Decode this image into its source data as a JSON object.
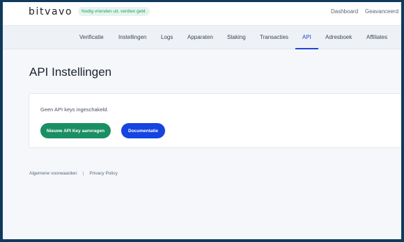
{
  "topbar": {
    "logo": "bitvavo",
    "promo": "Nodig vrienden uit, verdien geld.",
    "links": [
      "Dashboard",
      "Geavanceerd"
    ]
  },
  "subnav": {
    "tabs": [
      {
        "label": "Verificatie"
      },
      {
        "label": "Instellingen"
      },
      {
        "label": "Logs"
      },
      {
        "label": "Apparaten"
      },
      {
        "label": "Staking"
      },
      {
        "label": "Transacties"
      },
      {
        "label": "API"
      },
      {
        "label": "Adresboek"
      },
      {
        "label": "Affiliates"
      }
    ],
    "active": "API"
  },
  "main": {
    "title": "API Instellingen",
    "message": "Geen API keys ingeschakeld.",
    "primary_button": "Nieuwe API Key aanvragen",
    "secondary_button": "Documentatie"
  },
  "footer": {
    "terms": "Algemene voorwaarden",
    "separator": "|",
    "privacy": "Privacy Policy"
  },
  "colors": {
    "primary_green": "#1a8f63",
    "primary_blue": "#1544e0",
    "active_tab": "#1c46d6",
    "frame_border": "#0f3a5c"
  }
}
